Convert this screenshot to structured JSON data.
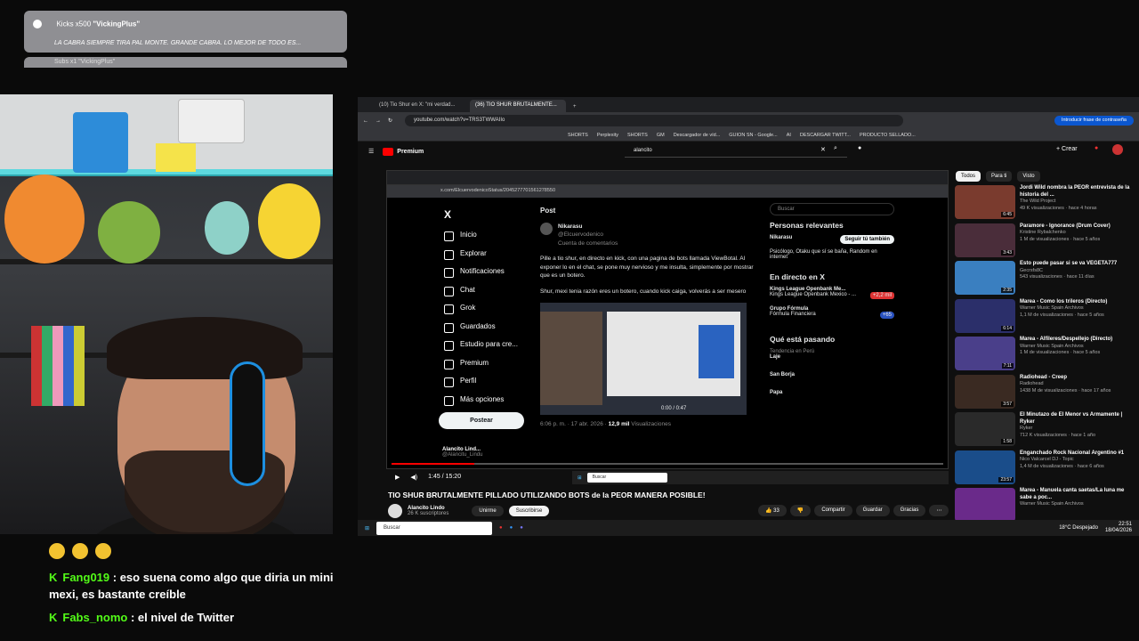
{
  "alert": {
    "title": "Kicks x500 ",
    "user": "\"VickingPlus\"",
    "message": "LA CABRA SIEMPRE TIRA PAL MONTE. GRANDE CABRA. LO MEJOR DE TODO ES...",
    "next": "Subs x1 \"VickingPlus\""
  },
  "chat": [
    {
      "user": "Fang019",
      "text": "eso suena como algo que diria un mini mexi, es bastante creíble",
      "color": "#53fc18"
    },
    {
      "user": "Fabs_nomo",
      "text": "el nivel de Twitter",
      "color": "#53fc18"
    }
  ],
  "browser": {
    "tabs": [
      "(10) Tio Shur en X: \"mi verdad...",
      "(36) TIO SHUR BRUTALMENTE..."
    ],
    "url": "youtube.com/watch?v=TRS3TWWAIIo",
    "password_btn": "Introducir frase de contraseña",
    "bookmarks": [
      "SHORTS",
      "Perplexity",
      "SHORTS",
      "GM",
      "Descargador de víd...",
      "GUION SN - Google...",
      "AI",
      "DESCARGAR TWITT...",
      "PRODUCTO SELLADO..."
    ],
    "yt_logo": "Premium",
    "yt_search": "alancito",
    "create": "Crear"
  },
  "x": {
    "url": "x.com/ElcuervodenicoStatus/2045277701561278550",
    "nav": [
      "Inicio",
      "Explorar",
      "Notificaciones",
      "Chat",
      "Grok",
      "Guardados",
      "Estudio para cre...",
      "Premium",
      "Perfil",
      "Más opciones"
    ],
    "post_btn": "Postear",
    "header": "Post",
    "author": "Nikarasu",
    "handle": "@Elcuervodenico",
    "community": "Cuenta de comentarios",
    "text1": "Pille a tio shur, en directo en kick, con una pagina de bots llamada ViewBotal. Al exponer lo en el chat, se pone muy nervioso y me insulta, simplemente por mostrar que es un botero.",
    "text2": "Shur, mexi tenia razón eres un botero, cuando kick caiga, volverás a ser mesero",
    "meta": "6:06 p. m. · 17 abr. 2026 ·",
    "views": "12,9 mil",
    "views_label": "Visualizaciones",
    "video_time": "0:00 / 0:47",
    "bottom_user": "Alancito Lind...",
    "bottom_handle": "@Alancitu_Lindu",
    "search": "Buscar",
    "relevant": "Personas relevantes",
    "follow": "Seguir tú también",
    "bio": "Psicólogo, Otaku que sí se baña, Random en internet",
    "live": "En directo en X",
    "live1": "Kings League Openbank Me...",
    "live1b": "Kings League Openbank Mexico - ...",
    "live_count": "+2,2 mil",
    "live2": "Grupo Fórmula",
    "live2b": "Fórmula Financiera",
    "live2_count": "+65",
    "trending": "Qué está pasando",
    "trend_cat": "Tendencia en Perú",
    "t1": "Laje",
    "t2": "San Borja",
    "t3": "Papa"
  },
  "player": {
    "time": "1:45 / 15:20"
  },
  "video": {
    "title": "TIO SHUR BRUTALMENTE PILLADO UTILIZANDO BOTS de la PEOR MANERA POSIBLE!",
    "channel": "Alancito Lindo",
    "subs": "26 K suscriptores",
    "unirme": "Unirme",
    "subscribe": "Suscribirse",
    "likes": "33",
    "share": "Compartir",
    "save": "Guardar",
    "thanks": "Gracias"
  },
  "chips": [
    "Todos",
    "Para ti",
    "Visto"
  ],
  "recs": [
    {
      "title": "Jordi Wild nombra la PEOR entrevista de la historia del ...",
      "ch": "The Wild Project",
      "meta": "49 K visualizaciones · hace 4 horas",
      "dur": "6:45",
      "color": "#7a3b2e"
    },
    {
      "title": "Paramore - Ignorance (Drum Cover)",
      "ch": "Kristine Rybalchenko",
      "meta": "1 M de visualizaciones · hace 5 años",
      "dur": "3:43",
      "color": "#4a2d3a"
    },
    {
      "title": "Esto puede pasar si se va VEGETA777",
      "ch": "Gecrsfs8C",
      "meta": "543 visualizaciones · hace 11 días",
      "dur": "2:35",
      "color": "#3a7fc0"
    },
    {
      "title": "Marea - Como los trileros (Directo)",
      "ch": "Warner Music Spain Archivos",
      "meta": "1,1 M de visualizaciones · hace 5 años",
      "dur": "6:14",
      "color": "#2b2f6a"
    },
    {
      "title": "Marea - Alfileres/Despellejo (Directo)",
      "ch": "Warner Music Spain Archivos",
      "meta": "1 M de visualizaciones · hace 5 años",
      "dur": "7:11",
      "color": "#4a3f8a"
    },
    {
      "title": "Radiohead - Creep",
      "ch": "Radiohead",
      "meta": "1438 M de visualizaciones · hace 17 años",
      "dur": "3:57",
      "color": "#3a2a22"
    },
    {
      "title": "El Minutazo de El Menor vs Armamente | Ryker",
      "ch": "Ryker",
      "meta": "712 K visualizaciones · hace 1 año",
      "dur": "1:58",
      "color": "#2a2a2a"
    },
    {
      "title": "Enganchado Rock Nacional Argentino #1",
      "ch": "Nico Valcarcel DJ - Topic",
      "meta": "1,4 M de visualizaciones · hace 6 años",
      "dur": "23:57",
      "color": "#1a4d8a"
    },
    {
      "title": "Marea - Manuela canta saetas/La luna me sabe a poc...",
      "ch": "Warner Music Spain Archivos",
      "meta": "",
      "dur": "",
      "color": "#6a2a8a"
    }
  ],
  "taskbar": {
    "search": "Buscar",
    "weather": "18°C Despejado",
    "time": "22:51",
    "date": "18/04/2026"
  }
}
